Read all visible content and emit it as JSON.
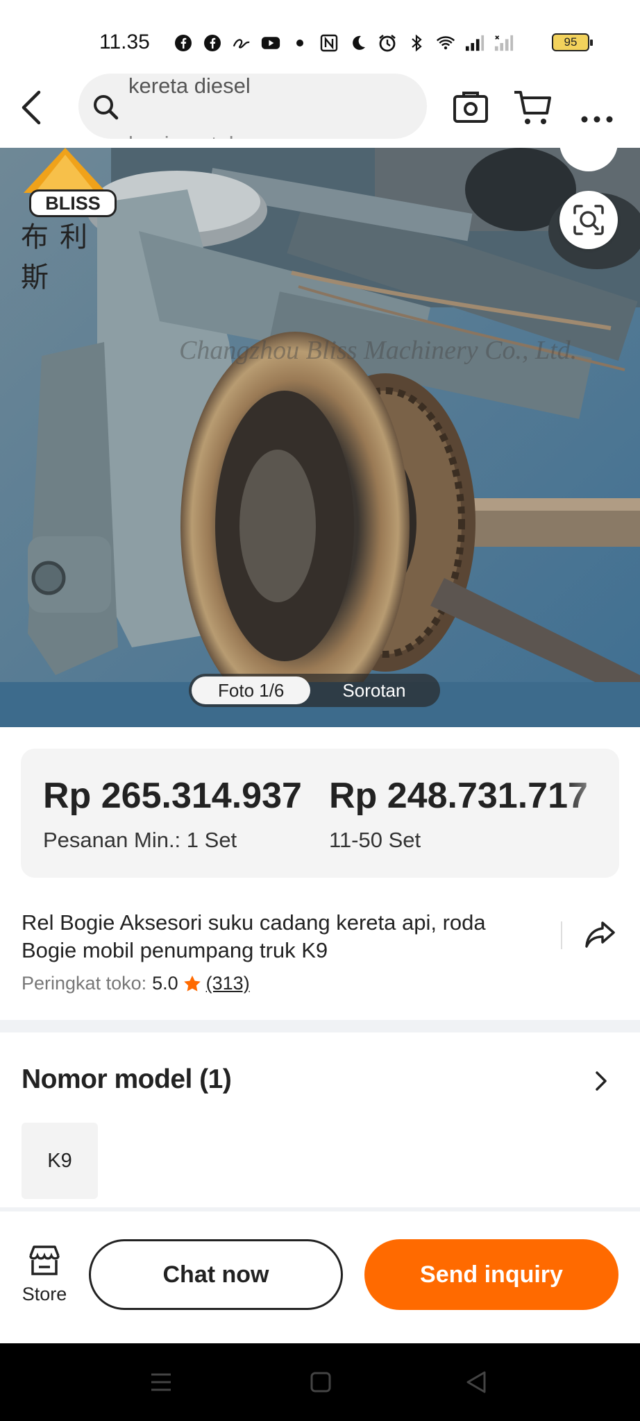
{
  "status_bar": {
    "time": "11.35",
    "battery": "95",
    "icons": [
      "facebook-icon",
      "facebook-icon",
      "app-icon",
      "youtube-icon",
      "dot-icon",
      "nfc-icon",
      "moon-icon",
      "alarm-icon",
      "bluetooth-icon",
      "wifi-icon",
      "signal-icon",
      "signal-icon"
    ]
  },
  "header": {
    "search_text": "kereta diesel",
    "search_text_second_line": "bogie untuk penumpang"
  },
  "product_image": {
    "logo_brand": "BLISS",
    "logo_chinese": "布利斯",
    "watermark": "Changzhou Bliss Machinery Co., Ltd.",
    "photo_counter": "Foto 1/6",
    "highlights_tab": "Sorotan"
  },
  "pricing": {
    "tiers": [
      {
        "price": "Rp 265.314.937",
        "quantity": "Pesanan Min.: 1 Set"
      },
      {
        "price": "Rp 248.731.717",
        "quantity": "11-50 Set"
      }
    ]
  },
  "product": {
    "title": "Rel Bogie Aksesori suku cadang kereta api, roda Bogie mobil penumpang truk K9",
    "rating_label": "Peringkat toko:",
    "rating_value": "5.0",
    "rating_count": "(313)"
  },
  "model_section": {
    "title": "Nomor model (1)",
    "models": [
      "K9"
    ]
  },
  "bottom_bar": {
    "store_label": "Store",
    "chat_label": "Chat now",
    "inquiry_label": "Send inquiry"
  },
  "colors": {
    "accent": "#ff6a00",
    "rating_star": "#ff6a00"
  }
}
